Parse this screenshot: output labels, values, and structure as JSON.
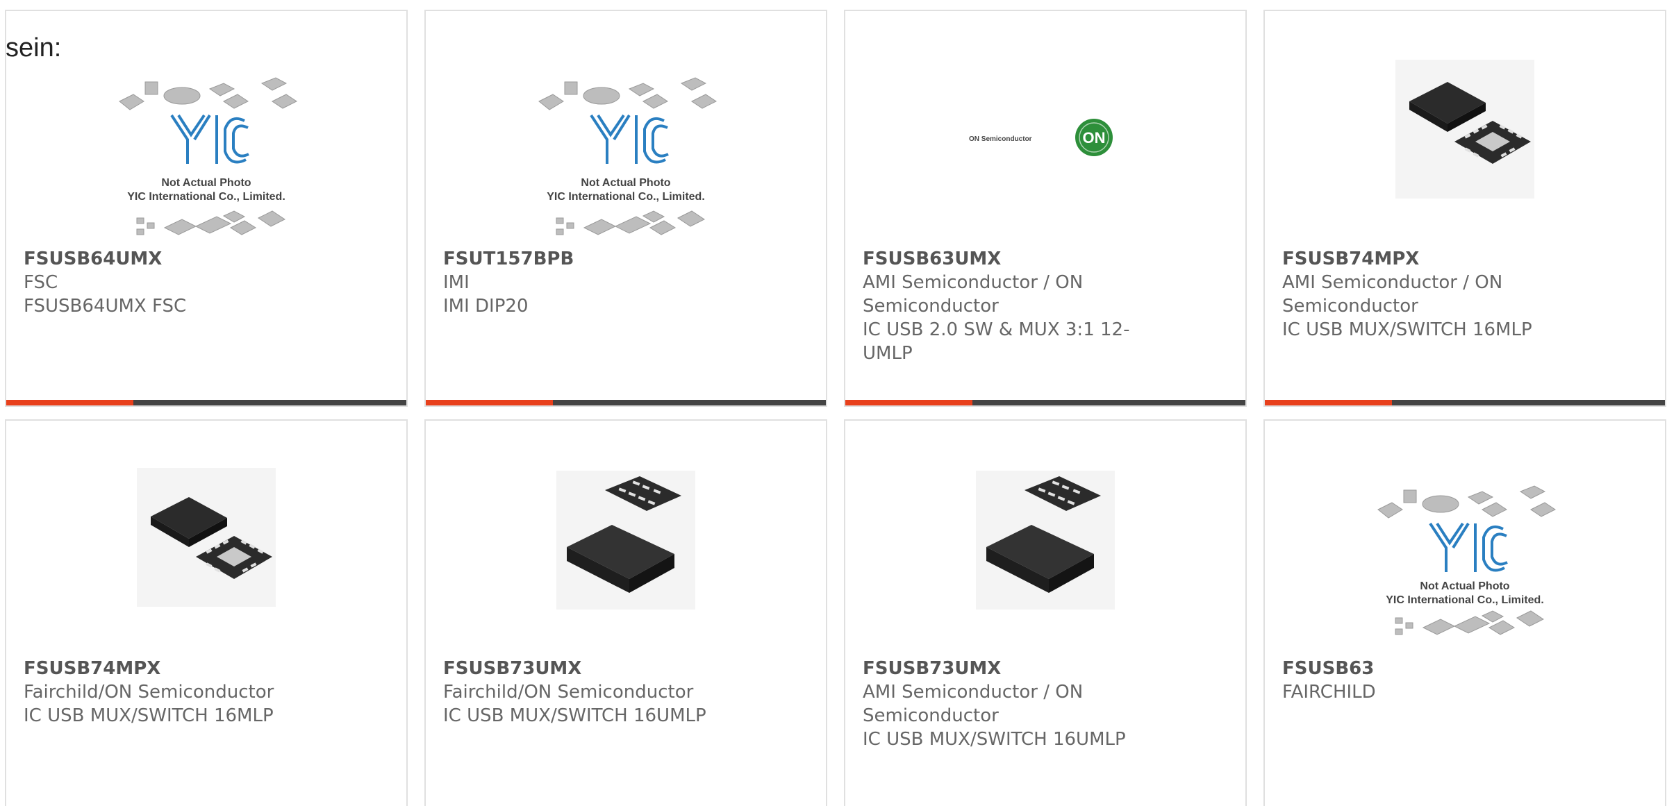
{
  "intro_text": "sein:",
  "placeholder": {
    "line1": "Not Actual Photo",
    "line2": "YIC International Co., Limited.",
    "brand": "YIC"
  },
  "on_logo": {
    "text": "ON Semiconductor",
    "badge": "ON"
  },
  "colors": {
    "accent": "#e8401c",
    "bar": "#444444",
    "card_border": "#e0e0e0",
    "yic_blue": "#2a7fc1",
    "on_green": "#2d8f3a"
  },
  "products": [
    {
      "part_number": "FSUSB64UMX",
      "maker": "FSC",
      "desc_lines": [
        "FSUSB64UMX FSC"
      ],
      "image": "yic-placeholder"
    },
    {
      "part_number": "FSUT157BPB",
      "maker": "IMI",
      "desc_lines": [
        "IMI DIP20"
      ],
      "image": "yic-placeholder"
    },
    {
      "part_number": "FSUSB63UMX",
      "maker": "AMI Semiconductor / ON Semiconductor",
      "desc_lines": [
        "IC USB 2.0 SW & MUX 3:1 12-",
        "UMLP"
      ],
      "image": "on-semiconductor-logo"
    },
    {
      "part_number": "FSUSB74MPX",
      "maker": "AMI Semiconductor / ON Semiconductor",
      "desc_lines": [
        "IC USB MUX/SWITCH 16MLP"
      ],
      "image": "qfn-chip-photo"
    },
    {
      "part_number": "FSUSB74MPX",
      "maker": "Fairchild/ON Semiconductor",
      "desc_lines": [
        "IC USB MUX/SWITCH 16MLP"
      ],
      "image": "qfn-chip-photo"
    },
    {
      "part_number": "FSUSB73UMX",
      "maker": "Fairchild/ON Semiconductor",
      "desc_lines": [
        "IC USB MUX/SWITCH 16UMLP"
      ],
      "image": "umlp-chip-photo"
    },
    {
      "part_number": "FSUSB73UMX",
      "maker": "AMI Semiconductor / ON Semiconductor",
      "desc_lines": [
        "IC USB MUX/SWITCH 16UMLP"
      ],
      "image": "umlp-chip-photo"
    },
    {
      "part_number": "FSUSB63",
      "maker": "FAIRCHILD",
      "desc_lines": [],
      "image": "yic-placeholder"
    }
  ]
}
